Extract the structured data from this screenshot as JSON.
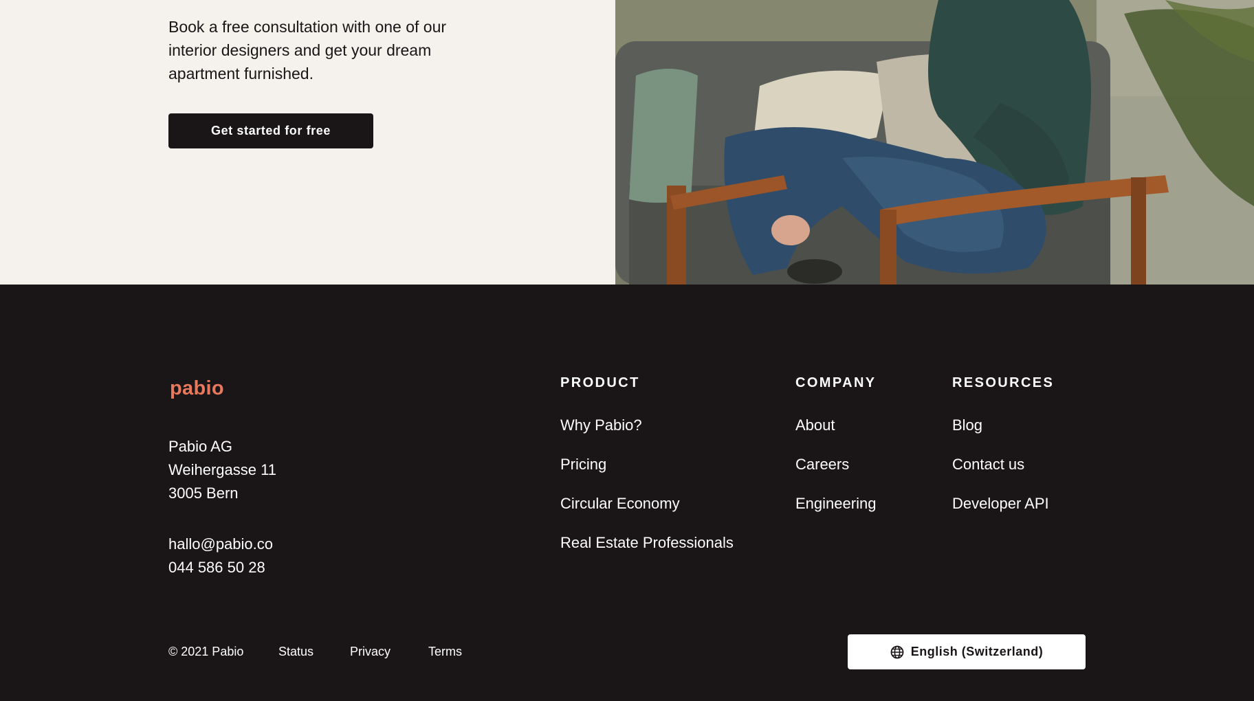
{
  "hero": {
    "text": "Book a free consultation with one of our interior designers and get your dream apartment furnished.",
    "cta_label": "Get started for free"
  },
  "footer": {
    "logo": "pabio",
    "address": [
      "Pabio AG",
      "Weihergasse 11",
      "3005 Bern"
    ],
    "email": "hallo@pabio.co",
    "phone": "044 586 50 28",
    "columns": [
      {
        "title": "PRODUCT",
        "links": [
          "Why Pabio?",
          "Pricing",
          "Circular Economy",
          "Real Estate Professionals"
        ]
      },
      {
        "title": "COMPANY",
        "links": [
          "About",
          "Careers",
          "Engineering"
        ]
      },
      {
        "title": "RESOURCES",
        "links": [
          "Blog",
          "Contact us",
          "Developer API"
        ]
      }
    ],
    "copyright": "© 2021 Pabio",
    "bottom_links": [
      "Status",
      "Privacy",
      "Terms"
    ],
    "language": "English (Switzerland)"
  }
}
